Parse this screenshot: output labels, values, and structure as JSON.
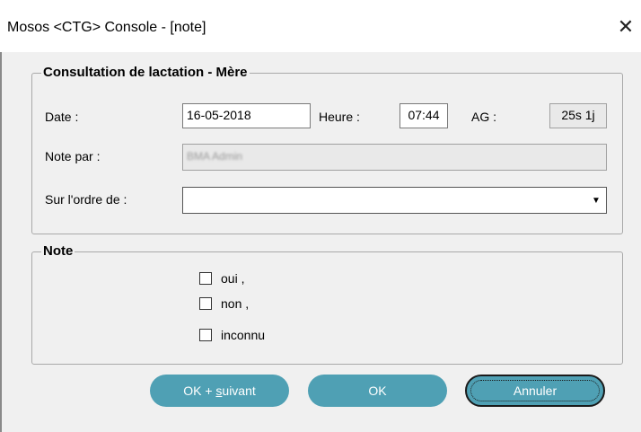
{
  "window": {
    "title": "Mosos <CTG> Console - [note]",
    "close_glyph": "✕"
  },
  "consult": {
    "legend": "Consultation de lactation - Mère",
    "date_label": "Date :",
    "date_value": "16-05-2018",
    "heure_label": "Heure :",
    "heure_value": "07:44",
    "ag_label": "AG :",
    "ag_value": "25s 1j",
    "note_par_label": "Note par :",
    "note_par_value": "BMA Admin",
    "ordre_label": "Sur l'ordre de :",
    "ordre_value": ""
  },
  "note": {
    "legend": "Note",
    "options": [
      "oui ,",
      "non ,",
      "inconnu"
    ]
  },
  "buttons": {
    "ok_suivant_prefix": "OK + ",
    "ok_suivant_underlined": "s",
    "ok_suivant_rest": "uivant",
    "ok": "OK",
    "annuler": "Annuler"
  }
}
